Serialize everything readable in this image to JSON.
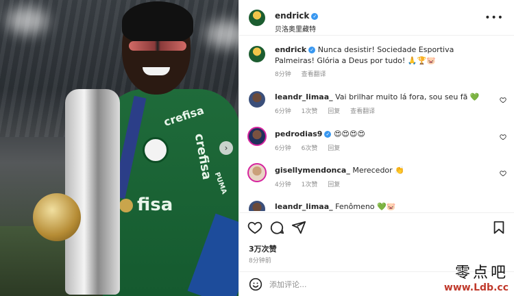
{
  "post": {
    "author": "endrick",
    "location": "贝洛奥里藏特",
    "more_icon": "more-icon"
  },
  "caption": {
    "username": "endrick",
    "text": "Nunca desistir! Sociedade Esportiva Palmeiras! Glória a Deus por tudo! 🙏🏆🐷",
    "time": "8分钟",
    "translate": "查看翻译"
  },
  "comments": [
    {
      "username": "leandr_limaa_",
      "text": "Vai brilhar muito lá fora, sou seu fã 💚",
      "time": "6分钟",
      "likes": "1次赞",
      "reply": "回复",
      "translate": "查看翻译"
    },
    {
      "username": "pedrodias9",
      "text": "😍😍😍😍",
      "time": "6分钟",
      "likes": "6次赞",
      "reply": "回复",
      "verified": true
    },
    {
      "username": "gisellymendonca_",
      "text": "Merecedor 👏",
      "time": "4分钟",
      "likes": "1次赞",
      "reply": "回复"
    },
    {
      "username": "leandr_limaa_",
      "text": "Fenômeno 💚🐷"
    }
  ],
  "actions": {
    "likes_count": "3万次赞",
    "posted_time": "8分钟前"
  },
  "comment_input": {
    "placeholder": "添加评论..."
  },
  "photo": {
    "shirt_sponsor": "crefisa",
    "shirt_brand": "PUMA",
    "shirt_chest": "fisa"
  },
  "watermark": {
    "cn": "零点吧",
    "url": "www.Ldb.cc"
  },
  "colors": {
    "verified": "#3897f0",
    "muted": "#8e8e8e",
    "text": "#262626",
    "palmeiras_green": "#1f6b3a"
  }
}
